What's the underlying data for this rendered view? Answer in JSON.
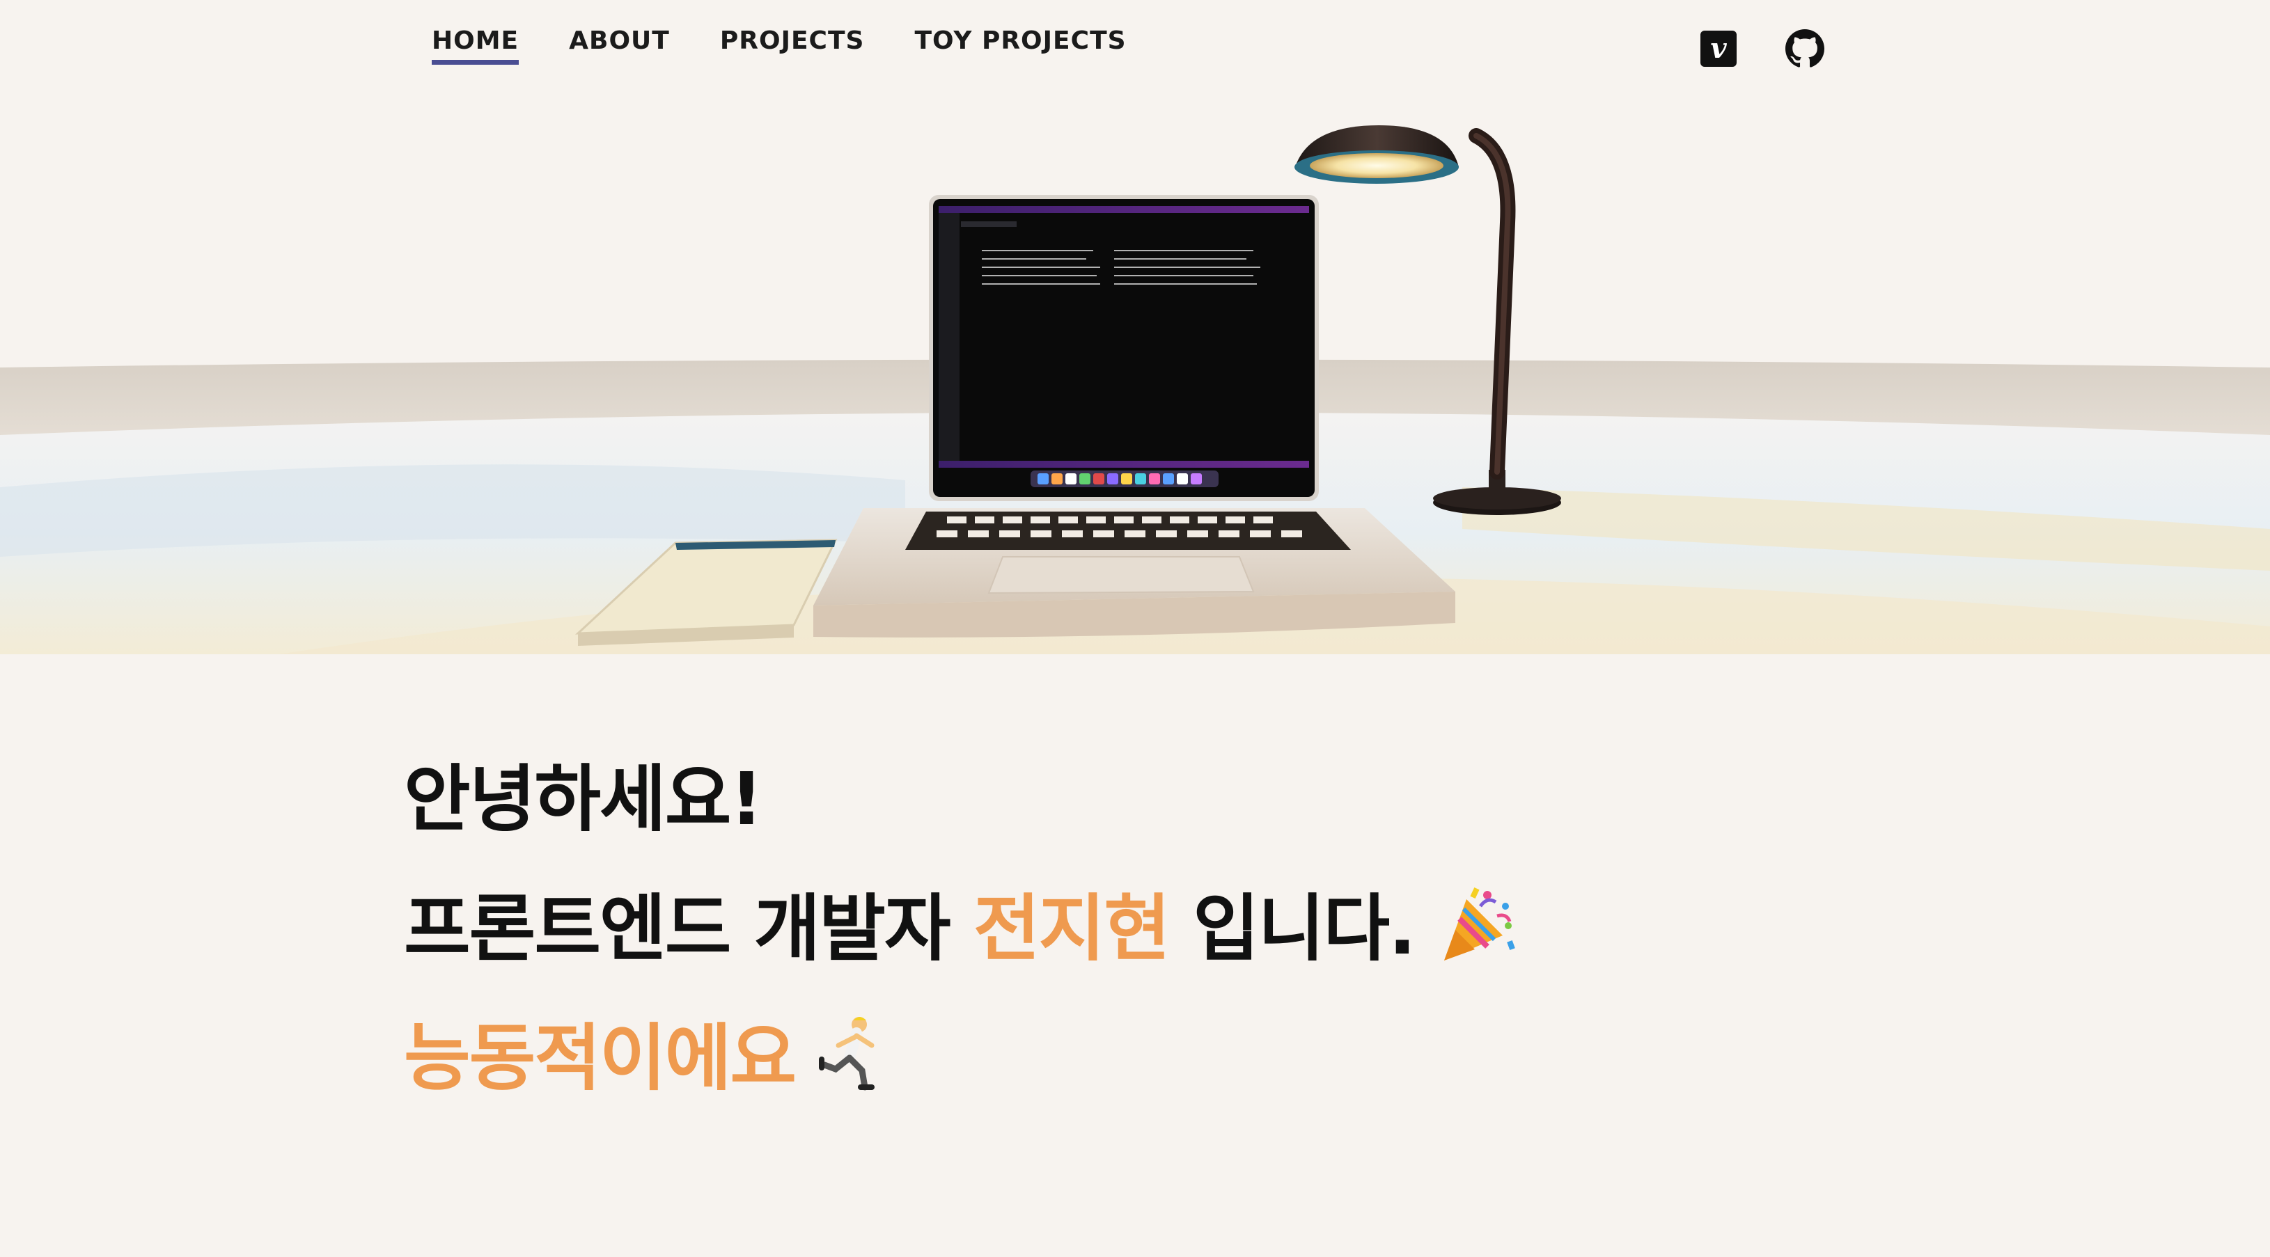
{
  "nav": {
    "items": [
      {
        "label": "HOME",
        "active": true
      },
      {
        "label": "ABOUT",
        "active": false
      },
      {
        "label": "PROJECTS",
        "active": false
      },
      {
        "label": "TOY PROJECTS",
        "active": false
      }
    ],
    "icons": [
      "velog-icon",
      "github-icon"
    ],
    "velog_letter": "v",
    "active_underline_color": "#4a4d92"
  },
  "intro": {
    "greeting": "안녕하세요!",
    "line2_prefix": "프론트엔드 개발자 ",
    "name": "전지현",
    "line2_suffix": " 입니다.",
    "line2_emoji": "party-popper-icon",
    "tagline": "능동적이에요",
    "tagline_emoji": "running-person-icon",
    "accent_color": "#ef9a4f",
    "text_color": "#111111"
  },
  "colors": {
    "background": "#f7f3ef"
  }
}
